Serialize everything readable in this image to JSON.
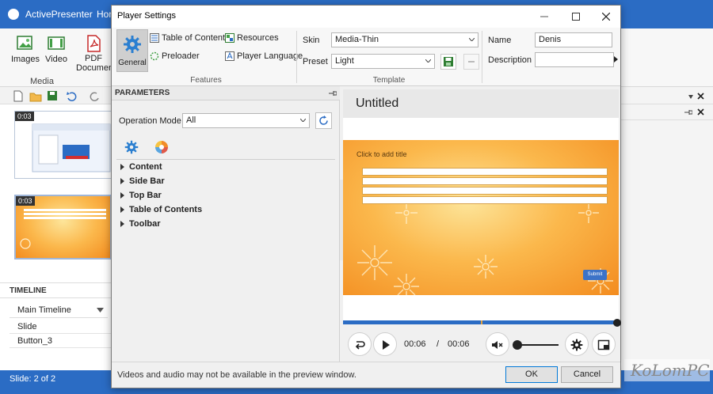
{
  "app": {
    "title": "ActivePresenter",
    "home_tab": "Hon",
    "ribbon": {
      "images_label": "Images",
      "video_label": "Video",
      "pdf_label": "PDF",
      "pdf_label2": "Documen",
      "group_media": "Media"
    },
    "slides": [
      {
        "number": "0:03"
      },
      {
        "number": "0:03"
      }
    ],
    "timeline": {
      "title": "TIMELINE",
      "selected": "Main Timeline",
      "rows": [
        "Slide",
        "Button_3"
      ]
    },
    "status": "Slide: 2 of 2",
    "watermark": "KoLomPC"
  },
  "dialog": {
    "title": "Player Settings",
    "features": {
      "general_label": "General",
      "table_of_contents": "Table of Contents",
      "resources": "Resources",
      "preloader": "Preloader",
      "player_language": "Player Language",
      "group_label": "Features"
    },
    "template": {
      "skin_label": "Skin",
      "skin_value": "Media-Thin",
      "preset_label": "Preset",
      "preset_value": "Light",
      "group_label": "Template"
    },
    "info": {
      "name_label": "Name",
      "name_value": "Denis",
      "description_label": "Description",
      "description_value": ""
    },
    "parameters": {
      "title": "PARAMETERS",
      "operation_mode_label": "Operation Mode",
      "operation_mode_value": "All",
      "tree": [
        "Content",
        "Side Bar",
        "Top Bar",
        "Table of Contents",
        "Toolbar"
      ]
    },
    "preview": {
      "title": "Untitled",
      "slide_title": "Click to add title",
      "submit_label": "Submit",
      "time_current": "00:06",
      "time_sep": "/",
      "time_total": "00:06",
      "progress_fraction": 1.0,
      "volume_fraction": 0.0
    },
    "footer": {
      "note": "Videos and audio may not be available in the preview window.",
      "ok": "OK",
      "cancel": "Cancel"
    }
  },
  "colors": {
    "accent": "#2b6cc4",
    "slide_orange": "#f38c1f",
    "gear_blue": "#2b7fd0"
  }
}
